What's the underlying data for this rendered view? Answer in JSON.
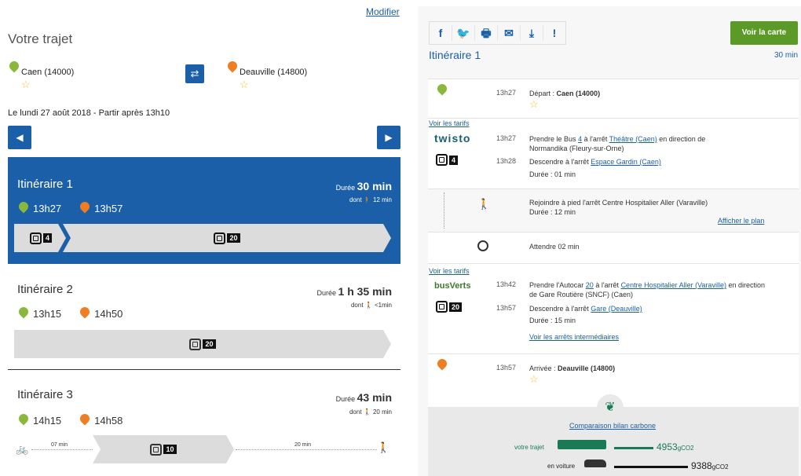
{
  "left": {
    "modify_link": "Modifier",
    "heading": "Votre trajet",
    "origin": "Caen (14000)",
    "destination": "Deauville (14800)",
    "date_line": "Le lundi 27 août 2018 - Partir après 13h10",
    "itineraries": [
      {
        "title": "Itinéraire 1",
        "duration_label": "Durée",
        "duration": "30 min",
        "walk_label": "dont",
        "walk": "12 min",
        "dep": "13h27",
        "arr": "13h57",
        "lines": [
          "4",
          "20"
        ]
      },
      {
        "title": "Itinéraire 2",
        "duration_label": "Durée",
        "duration": "1 h 35 min",
        "walk_label": "dont",
        "walk": "<1min",
        "dep": "13h15",
        "arr": "14h50",
        "lines": [
          "20"
        ]
      },
      {
        "title": "Itinéraire 3",
        "duration_label": "Durée",
        "duration": "43 min",
        "walk_label": "dont",
        "walk": "20 min",
        "dep": "14h15",
        "arr": "14h58",
        "lines": [
          "10"
        ],
        "bike": "07 min",
        "walk_end": "20 min"
      }
    ]
  },
  "right": {
    "show_map": "Voir la carte",
    "title": "Itinéraire 1",
    "total": "30 min",
    "depart": {
      "time": "13h27",
      "label": "Départ :",
      "place": "Caen (14000)"
    },
    "tarifs": "Voir les tarifs",
    "bus1": {
      "brand": "twisto",
      "t1": "13h27",
      "text1a": "Prendre le Bus",
      "line": "4",
      "text1b": "à l'arrêt",
      "stop1": "Théâtre (Caen)",
      "text1c": "en direction de",
      "dir": "Normandika (Fleury-sur-Orne)",
      "t2": "13h28",
      "text2": "Descendre à l'arrêt",
      "stop2": "Espace Gardin (Caen)",
      "dur": "Durée : 01 min"
    },
    "walk": {
      "text": "Rejoindre à pied l'arrêt Centre Hospitalier Aller (Varaville)",
      "dur": "Durée : 12 min",
      "plan": "Afficher le plan"
    },
    "wait": {
      "text": "Attendre 02 min"
    },
    "bus2": {
      "brand": "busVerts",
      "t1": "13h42",
      "text1a": "Prendre l'Autocar",
      "line": "20",
      "text1b": "à l'arrêt",
      "stop1": "Centre Hospitalier Aller (Varaville)",
      "text1c": "en direction de Gare Routière (SNCF) (Caen)",
      "t2": "13h57",
      "text2": "Descendre à l'arrêt",
      "stop2": "Gare (Deauville)",
      "dur": "Durée : 15 min",
      "stops": "Voir les arrêts intermédiaires"
    },
    "arrive": {
      "time": "13h57",
      "label": "Arrivée :",
      "place": "Deauville (14800)"
    },
    "carbon": {
      "title": "Comparaison bilan carbone",
      "trip_label": "votre trajet",
      "trip_value": "4953",
      "car_label": "en voiture",
      "car_value": "9388",
      "unit": "gCO2"
    }
  },
  "colors": {
    "primary": "#1b5fa8",
    "green": "#8ab83d",
    "orange": "#ef7d22",
    "carbon": "#1a7a55"
  }
}
